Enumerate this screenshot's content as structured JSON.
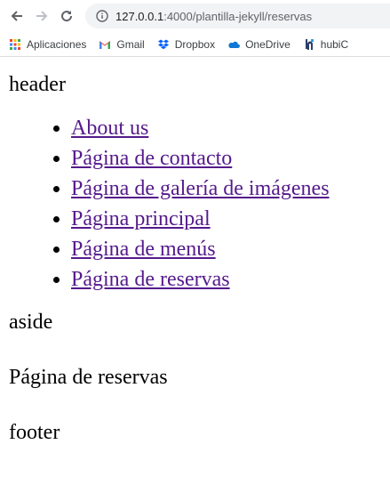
{
  "browser": {
    "url_host": "127.0.0.1",
    "url_path": ":4000/plantilla-jekyll/reservas"
  },
  "bookmarks": [
    {
      "label": "Aplicaciones",
      "icon": "apps-grid-icon"
    },
    {
      "label": "Gmail",
      "icon": "gmail-icon"
    },
    {
      "label": "Dropbox",
      "icon": "dropbox-icon"
    },
    {
      "label": "OneDrive",
      "icon": "onedrive-icon"
    },
    {
      "label": "hubiC",
      "icon": "hubic-icon"
    }
  ],
  "page": {
    "header": "header",
    "nav": [
      "About us",
      "Página de contacto",
      "Página de galería de imágenes",
      "Página principal",
      "Página de menús",
      "Página de reservas"
    ],
    "aside": "aside",
    "main": "Página de reservas",
    "footer": "footer"
  },
  "colors": {
    "link_visited": "#551a8b",
    "omnibox_bg": "#f1f3f4"
  }
}
